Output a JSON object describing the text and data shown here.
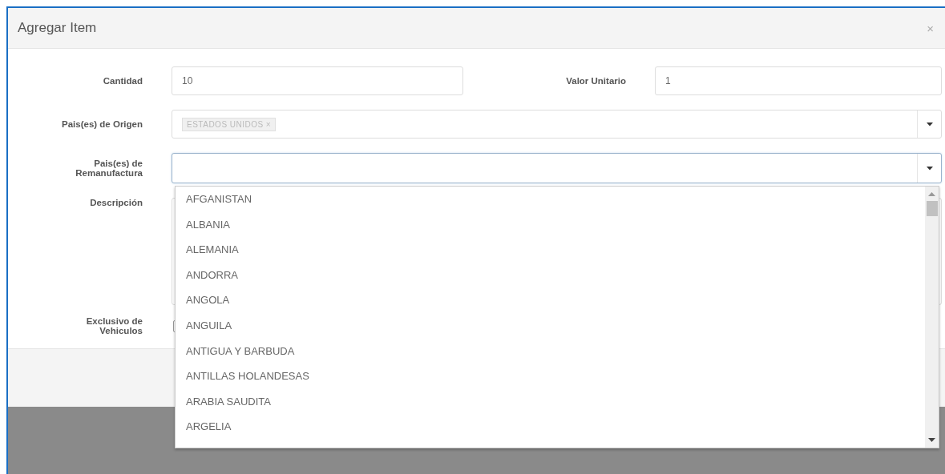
{
  "dialog": {
    "title": "Agregar Item",
    "close": "×"
  },
  "form": {
    "rows": [
      {
        "kind": "pair",
        "fields": [
          {
            "label": "Cantidad",
            "value": "10"
          },
          {
            "label": "Valor Unitario",
            "value": "1"
          }
        ]
      },
      {
        "kind": "tags",
        "label": "Pais(es) de Origen",
        "tags": [
          {
            "text": "ESTADOS UNIDOS",
            "remove": "×"
          }
        ]
      },
      {
        "kind": "select",
        "label": "Pais(es) de Remanufactura",
        "focused": true
      },
      {
        "kind": "textarea",
        "label": "Descripción"
      },
      {
        "kind": "checkbox",
        "label": "Exclusivo de Vehiculos",
        "checked": false
      }
    ]
  },
  "dropdown": {
    "options": [
      {
        "text": "AFGANISTAN"
      },
      {
        "text": "ALBANIA"
      },
      {
        "text": "ALEMANIA"
      },
      {
        "text": "ANDORRA"
      },
      {
        "text": "ANGOLA"
      },
      {
        "text": "ANGUILA"
      },
      {
        "text": "ANTIGUA Y BARBUDA"
      },
      {
        "text": "ANTILLAS HOLANDESAS"
      },
      {
        "text": "ARABIA SAUDITA"
      },
      {
        "text": "ARGELIA"
      }
    ]
  }
}
